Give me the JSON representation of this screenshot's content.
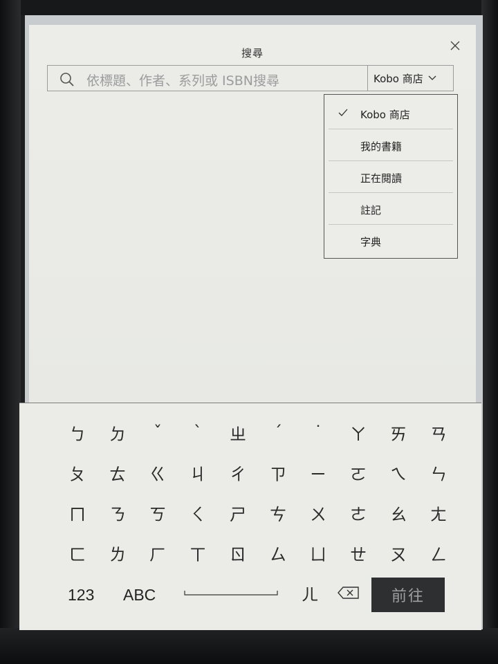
{
  "dialog": {
    "title": "搜尋",
    "close_icon": "close-icon"
  },
  "search": {
    "placeholder": "依標題、作者、系列或 ISBN搜尋",
    "store_selected": "Kobo 商店"
  },
  "dropdown": {
    "items": [
      {
        "label": "Kobo 商店",
        "checked": true
      },
      {
        "label": "我的書籍",
        "checked": false
      },
      {
        "label": "正在閱讀",
        "checked": false
      },
      {
        "label": "註記",
        "checked": false
      },
      {
        "label": "字典",
        "checked": false
      }
    ]
  },
  "keyboard": {
    "rows": [
      [
        "ㄅ",
        "ㄉ",
        "ˇ",
        "ˋ",
        "ㄓ",
        "ˊ",
        "˙",
        "ㄚ",
        "ㄞ",
        "ㄢ"
      ],
      [
        "ㄆ",
        "ㄊ",
        "ㄍ",
        "ㄐ",
        "ㄔ",
        "ㄗ",
        "ㄧ",
        "ㄛ",
        "ㄟ",
        "ㄣ"
      ],
      [
        "ㄇ",
        "ㄋ",
        "ㄎ",
        "ㄑ",
        "ㄕ",
        "ㄘ",
        "ㄨ",
        "ㄜ",
        "ㄠ",
        "ㄤ"
      ],
      [
        "ㄈ",
        "ㄌ",
        "ㄏ",
        "ㄒ",
        "ㄖ",
        "ㄙ",
        "ㄩ",
        "ㄝ",
        "ㄡ",
        "ㄥ"
      ]
    ],
    "numbers_label": "123",
    "abc_label": "ABC",
    "er_key": "ㄦ",
    "go_label": "前往"
  }
}
